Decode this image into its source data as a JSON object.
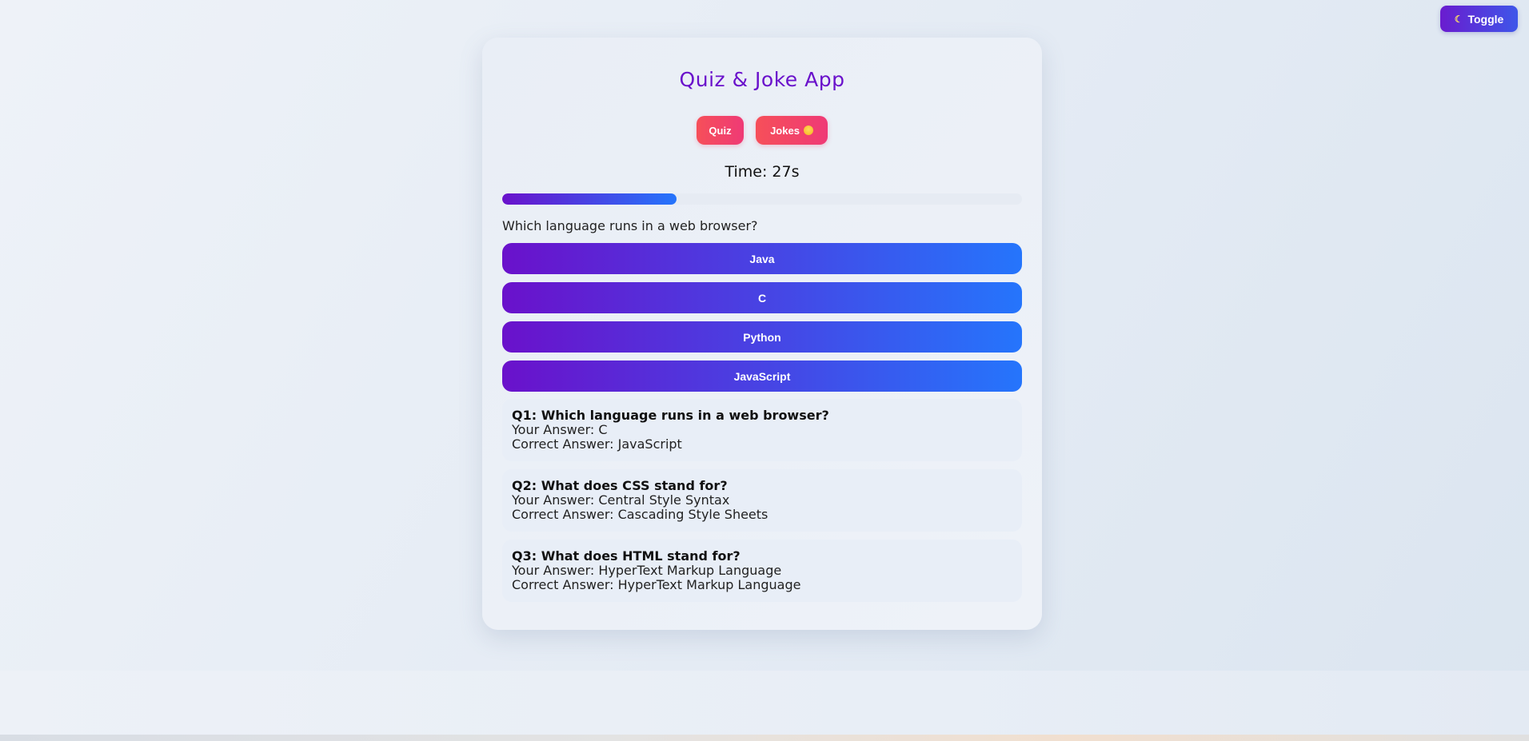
{
  "toggle": {
    "icon": "moon-icon",
    "label": "Toggle"
  },
  "app": {
    "title": "Quiz & Joke App"
  },
  "tabs": [
    {
      "label": "Quiz"
    },
    {
      "label": "Jokes",
      "icon": "grinning-emoji-icon"
    }
  ],
  "timer": {
    "text": "Time: 27s",
    "progress": 0.335
  },
  "question": {
    "text": "Which language runs in a web browser?",
    "options": [
      "Java",
      "C",
      "Python",
      "JavaScript"
    ]
  },
  "results": [
    {
      "question": "Q1: Which language runs in a web browser?",
      "your_answer": "Your Answer: C",
      "correct_answer": "Correct Answer: JavaScript"
    },
    {
      "question": "Q2: What does CSS stand for?",
      "your_answer": "Your Answer: Central Style Syntax",
      "correct_answer": "Correct Answer: Cascading Style Sheets"
    },
    {
      "question": "Q3: What does HTML stand for?",
      "your_answer": "Your Answer: HyperText Markup Language",
      "correct_answer": "Correct Answer: HyperText Markup Language"
    }
  ],
  "colors": {
    "accent_purple": "#6a11cb",
    "accent_blue": "#2575fc",
    "tab_red": "#f64f59",
    "tab_pink": "#ef3a76"
  }
}
